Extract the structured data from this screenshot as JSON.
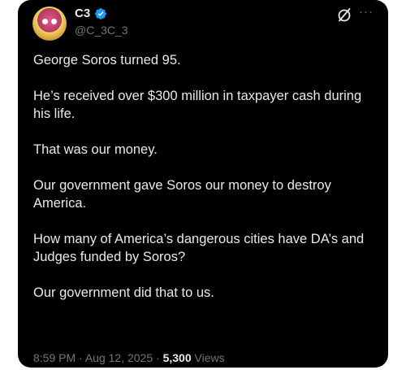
{
  "post": {
    "author": {
      "display_name": "C3",
      "handle": "@C_3C_3",
      "verified": true,
      "verified_icon": "verified-badge-icon"
    },
    "actions": {
      "grok_icon": "grok-slash-icon",
      "more_label": "···"
    },
    "paragraphs": [
      "George Soros turned 95.",
      "He’s received over $300 million in taxpayer cash during his life.",
      "That was our money.",
      "Our government gave Soros our money to destroy America.",
      "How many of America’s dangerous cities have DA’s and Judges funded by Soros?",
      "Our government did that to us."
    ],
    "meta": {
      "time": "8:59 PM",
      "separator": "·",
      "date": "Aug 12, 2025",
      "views_count": "5,300",
      "views_label": "Views"
    }
  },
  "colors": {
    "background": "#000000",
    "text_primary": "#e7e9ea",
    "text_secondary": "#71767b",
    "verified_blue": "#1d9bf0"
  }
}
